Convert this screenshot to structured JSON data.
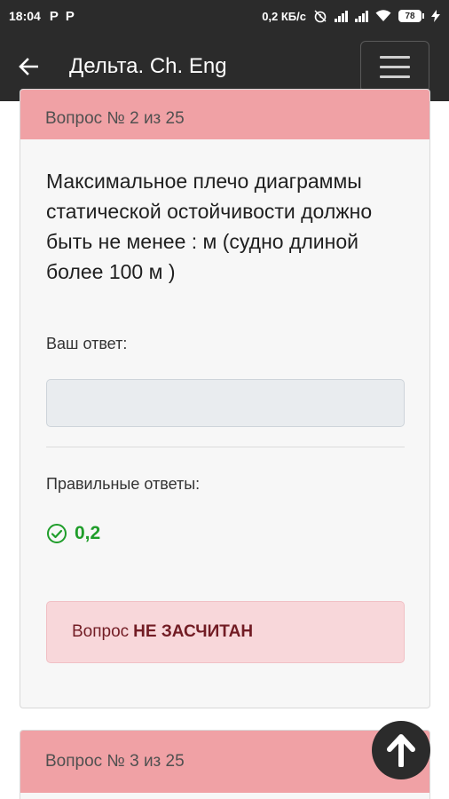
{
  "status_bar": {
    "time": "18:04",
    "notif_icons": [
      "P",
      "P"
    ],
    "speed": "0,2 КБ/с",
    "battery": "78"
  },
  "app_bar": {
    "title": "Дельта. Ch. Eng"
  },
  "question_card": {
    "header": "Вопрос № 2 из 25",
    "text": "Максимальное плечо диаграммы статической остойчивости должно быть не менее : м (судно длиной более 100 м )",
    "your_answer_label": "Ваш ответ:",
    "your_answer_value": "",
    "correct_label": "Правильные ответы:",
    "correct_value": "0,2",
    "verdict_prefix": "Вопрос",
    "verdict_status": "НЕ ЗАСЧИТАН"
  },
  "next_card": {
    "header": "Вопрос № 3 из 25"
  },
  "colors": {
    "header_bg": "#f0a1a5",
    "app_bar_bg": "#2b2b2b",
    "correct_green": "#1f9d2a",
    "alert_bg": "#f8d7da",
    "alert_text": "#721c24"
  }
}
